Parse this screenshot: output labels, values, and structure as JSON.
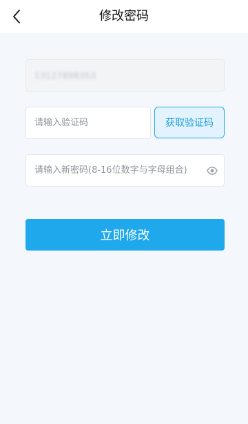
{
  "header": {
    "title": "修改密码",
    "back_icon": "chevron-left-icon"
  },
  "form": {
    "phone_value": "13127898353",
    "code_placeholder": "请输入验证码",
    "get_code_label": "获取验证码",
    "password_placeholder": "请输入新密码(8-16位数字与字母组合)",
    "toggle_icon": "eye-icon",
    "submit_label": "立即修改"
  },
  "colors": {
    "accent": "#1fa8ec",
    "background": "#f4f8fc",
    "button_light_bg": "#e3f3fd"
  }
}
